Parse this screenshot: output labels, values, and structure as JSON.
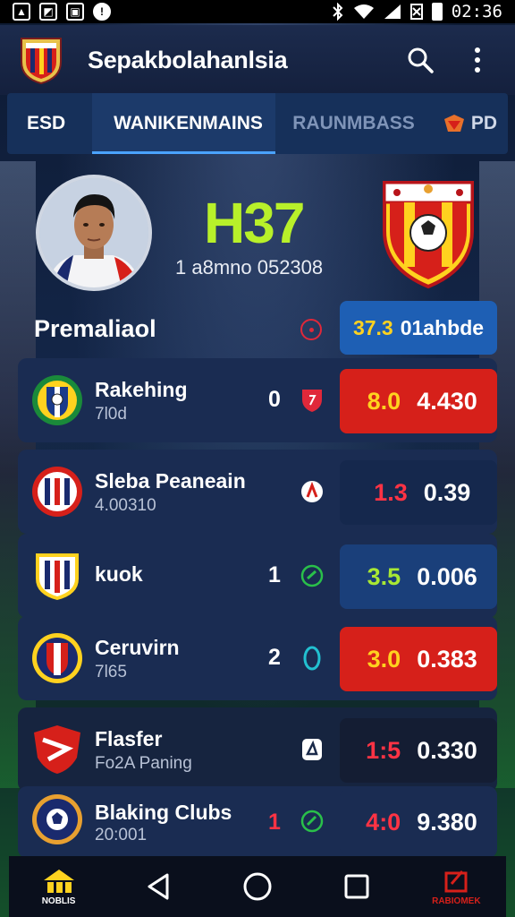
{
  "status_bar": {
    "time": "02:36"
  },
  "app_bar": {
    "title": "Sepakbolahanlsia"
  },
  "tabs": [
    {
      "label": "ESD"
    },
    {
      "label": "WANIKENMAINS"
    },
    {
      "label": "RAUNMBASS"
    },
    {
      "label": "PD"
    }
  ],
  "hero": {
    "score": "H37",
    "subtitle": "1 a8mno 052308"
  },
  "section": {
    "title": "Premaliaol",
    "pill_highlight": "37.3",
    "pill_text": "01ahbde"
  },
  "matches": [
    {
      "name": "Rakehing",
      "sub": "7l0d",
      "count": "0",
      "odd1": "8.0",
      "odd2": "4.430",
      "odd1_color": "#ffd21f",
      "box_color": "#d6201a"
    },
    {
      "name": "Sleba Peaneain",
      "sub": "4.00310",
      "count": "",
      "odd1": "1.3",
      "odd2": "0.39",
      "odd1_color": "#ff3344",
      "box_color": "#15284d"
    },
    {
      "name": "kuok",
      "sub": "",
      "count": "1",
      "odd1": "3.5",
      "odd2": "0.006",
      "odd1_color": "#a8e834",
      "box_color": "#1a3f7a"
    },
    {
      "name": "Ceruvirn",
      "sub": "7l65",
      "count": "2",
      "odd1": "3.0",
      "odd2": "0.383",
      "odd1_color": "#ffd21f",
      "box_color": "#d6201a"
    },
    {
      "name": "Flasfer",
      "sub": "Fo2A Paning",
      "count": "",
      "odd1": "1:5",
      "odd2": "0.330",
      "odd1_color": "#ff3344",
      "box_color": "#141d33"
    },
    {
      "name": "Blaking Clubs",
      "sub": "20:001",
      "count": "1",
      "odd1": "4:0",
      "odd2": "9.380",
      "odd1_color": "#ff3344",
      "box_color": "#1a2c52"
    }
  ],
  "bottom_nav": {
    "home_label": "NOBLIS",
    "right_label": "RABIOMEK"
  },
  "colors": {
    "accent_green": "#b8f02a",
    "accent_blue": "#1e5fb4",
    "accent_red": "#d6201a"
  }
}
